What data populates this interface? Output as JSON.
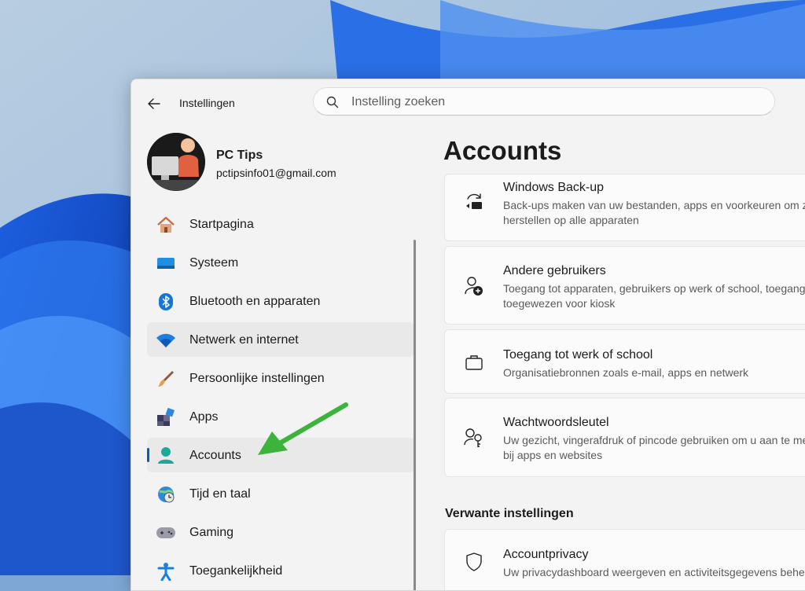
{
  "app": {
    "title": "Instellingen"
  },
  "search": {
    "placeholder": "Instelling zoeken"
  },
  "profile": {
    "name": "PC Tips",
    "email": "pctipsinfo01@gmail.com"
  },
  "sidebar": {
    "items": [
      {
        "label": "Startpagina",
        "icon": "home-icon"
      },
      {
        "label": "Systeem",
        "icon": "system-display-icon"
      },
      {
        "label": "Bluetooth en apparaten",
        "icon": "bluetooth-icon"
      },
      {
        "label": "Netwerk en internet",
        "icon": "wifi-icon"
      },
      {
        "label": "Persoonlijke instellingen",
        "icon": "paintbrush-icon"
      },
      {
        "label": "Apps",
        "icon": "apps-icon"
      },
      {
        "label": "Accounts",
        "icon": "account-person-icon"
      },
      {
        "label": "Tijd en taal",
        "icon": "time-language-icon"
      },
      {
        "label": "Gaming",
        "icon": "gamepad-icon"
      },
      {
        "label": "Toegankelijkheid",
        "icon": "accessibility-icon"
      }
    ],
    "active_index": 6
  },
  "main": {
    "title": "Accounts",
    "cards": [
      {
        "title": "Windows Back-up",
        "desc": [
          "Back-ups maken van uw bestanden, apps en voorkeuren om ze te",
          "herstellen op alle apparaten"
        ],
        "icon": "backup-sync-icon"
      },
      {
        "title": "Andere gebruikers",
        "desc": [
          "Toegang tot apparaten, gebruikers op werk of school, toegang",
          "toegewezen voor kiosk"
        ],
        "icon": "add-user-icon"
      },
      {
        "title": "Toegang tot werk of school",
        "desc": [
          "Organisatiebronnen zoals e-mail, apps en netwerk"
        ],
        "icon": "briefcase-icon"
      },
      {
        "title": "Wachtwoordsleutel",
        "desc": [
          "Uw gezicht, vingerafdruk of pincode gebruiken om u aan te melden",
          "bij apps en websites"
        ],
        "icon": "passkey-icon"
      }
    ],
    "related_header": "Verwante instellingen",
    "related": [
      {
        "title": "Accountprivacy",
        "desc": [
          "Uw privacydashboard weergeven en activiteitsgegevens beheren"
        ],
        "icon": "shield-icon"
      }
    ]
  },
  "colors": {
    "accent": "#005fb8",
    "arrow": "#3cb43c"
  }
}
